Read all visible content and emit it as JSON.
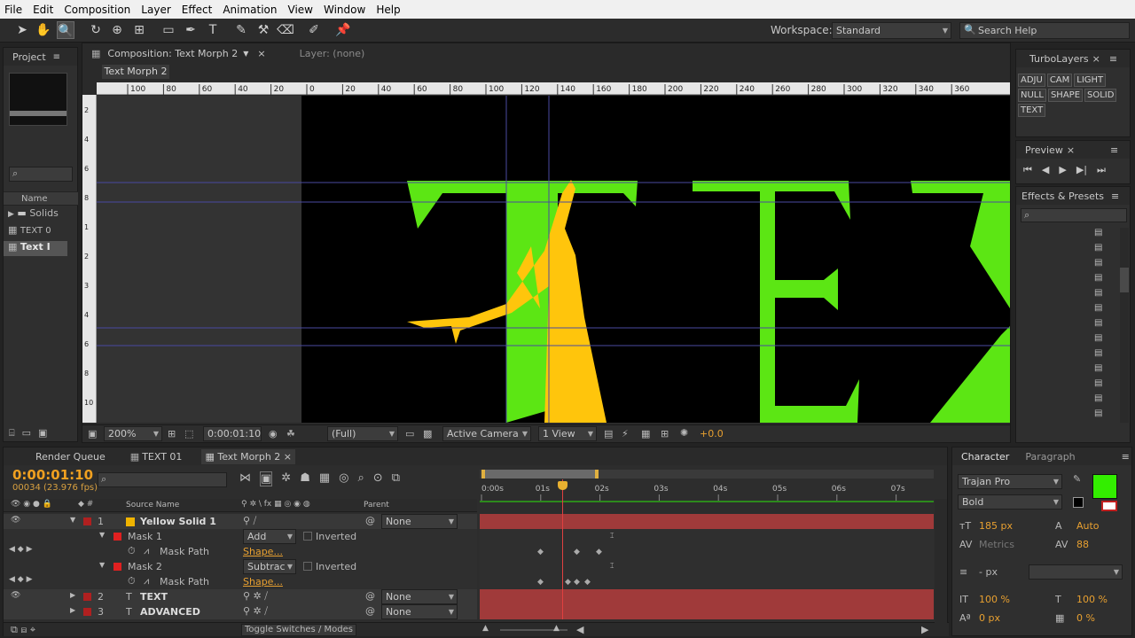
{
  "menu": [
    "File",
    "Edit",
    "Composition",
    "Layer",
    "Effect",
    "Animation",
    "View",
    "Window",
    "Help"
  ],
  "workspace": {
    "label": "Workspace:",
    "value": "Standard"
  },
  "search_help": {
    "placeholder": "Search Help"
  },
  "project": {
    "tab": "Project",
    "name_col": "Name",
    "items": [
      "Solids",
      "TEXT 0",
      "Text I"
    ]
  },
  "comp_viewer": {
    "tab": "Composition: Text Morph 2",
    "layer_tab": "Layer: (none)",
    "subtab": "Text Morph 2",
    "ruler_labels": [
      "100",
      "80",
      "60",
      "40",
      "20",
      "0",
      "20",
      "40",
      "60",
      "80",
      "100",
      "120",
      "140",
      "160",
      "180",
      "200",
      "220",
      "240",
      "260",
      "280",
      "300",
      "320",
      "340",
      "360"
    ],
    "left_ruler": [
      "2",
      "4",
      "6",
      "8",
      "1",
      "2",
      "3",
      "4",
      "6",
      "8",
      "10"
    ],
    "zoom": "200%",
    "timecode": "0:00:01:10",
    "resolution": "(Full)",
    "camera": "Active Camera",
    "view": "1 View",
    "offset": "+0.0",
    "canvas_text": "TEX"
  },
  "turbolayers": {
    "tab": "TurboLayers",
    "buttons": [
      "ADJU",
      "CAM",
      "LIGHT",
      "NULL",
      "SHAPE",
      "SOLID",
      "TEXT"
    ]
  },
  "preview": {
    "tab": "Preview"
  },
  "effects": {
    "tab": "Effects & Presets"
  },
  "timeline": {
    "tabs": [
      "Render Queue",
      "TEXT 01",
      "Text Morph 2"
    ],
    "timecode": "0:00:01:10",
    "frame_info": "00034 (23.976 fps)",
    "col_source": "Source Name",
    "col_parent": "Parent",
    "ruler": [
      "0:00s",
      "01s",
      "02s",
      "03s",
      "04s",
      "05s",
      "06s",
      "07s"
    ],
    "layers": [
      {
        "num": "1",
        "name": "Yellow Solid 1",
        "parent": "None",
        "color": "#f0b400"
      },
      {
        "name": "Mask 1",
        "mode": "Add",
        "inverted": "Inverted"
      },
      {
        "name": "Mask Path",
        "value": "Shape..."
      },
      {
        "name": "Mask 2",
        "mode": "Subtrac",
        "inverted": "Inverted"
      },
      {
        "name": "Mask Path",
        "value": "Shape..."
      },
      {
        "num": "2",
        "name": "TEXT",
        "parent": "None"
      },
      {
        "num": "3",
        "name": "ADVANCED",
        "parent": "None"
      }
    ],
    "toggle": "Toggle Switches / Modes"
  },
  "character": {
    "tabs": [
      "Character",
      "Paragraph"
    ],
    "font": "Trajan Pro",
    "style": "Bold",
    "size": "185 px",
    "leading": "Auto",
    "kerning": "Metrics",
    "tracking": "88",
    "stroke": "- px",
    "vscale": "100 %",
    "hscale": "100 %",
    "baseline": "0 px",
    "tsume": "0 %",
    "fill_color": "#33ee00"
  },
  "colors": {
    "text_green": "#5ce614",
    "morph_yellow": "#ffc50c",
    "timecode_orange": "#f0a020"
  }
}
